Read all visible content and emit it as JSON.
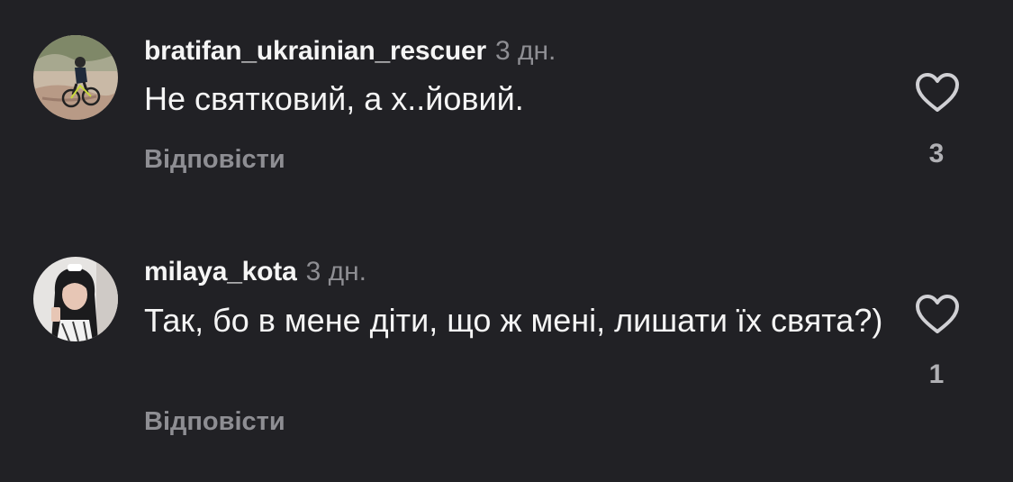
{
  "comments": [
    {
      "username": "bratifan_ukrainian_rescuer",
      "time": "3 дн.",
      "text": "Не святковий, а х..йовий.",
      "reply_label": "Відповісти",
      "likes": "3",
      "avatar_icon": "avatar-cyclist-photo",
      "like_icon": "heart-outline-icon"
    },
    {
      "username": "milaya_kota",
      "time": "3 дн.",
      "text": "Так, бо в мене діти, що ж мені, лишати їх свята?)",
      "reply_label": "Відповісти",
      "likes": "1",
      "avatar_icon": "avatar-woman-selfie-photo",
      "like_icon": "heart-outline-icon"
    }
  ],
  "colors": {
    "background": "#212125",
    "primary_text": "#f5f5f5",
    "secondary_text": "#8e8e93",
    "heart_stroke": "#d0d0d4"
  }
}
